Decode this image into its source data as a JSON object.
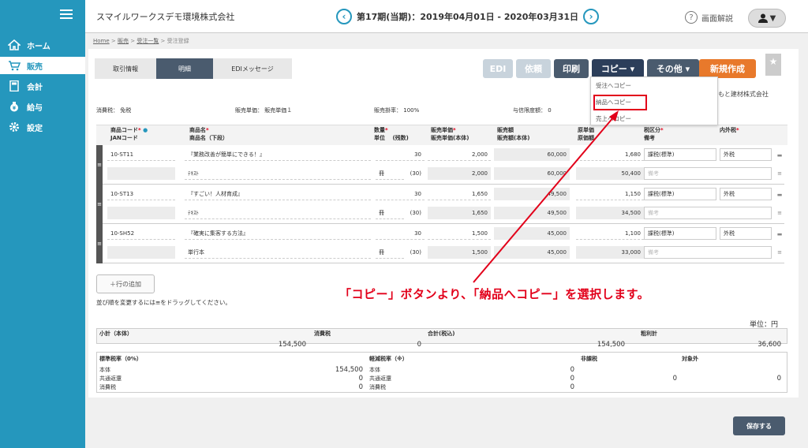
{
  "sidebar": {
    "items": [
      {
        "label": "ホーム",
        "icon": "home-icon"
      },
      {
        "label": "販売",
        "icon": "cart-icon"
      },
      {
        "label": "会計",
        "icon": "calculator-icon"
      },
      {
        "label": "給与",
        "icon": "moneybag-icon"
      },
      {
        "label": "設定",
        "icon": "gear-icon"
      }
    ]
  },
  "header": {
    "company": "スマイルワークスデモ環境株式会社",
    "period": "第17期(当期)：2019年04月01日 - 2020年03月31日",
    "help": "画面解説",
    "prev": "‹",
    "next": "›"
  },
  "breadcrumb": {
    "home": "Home",
    "sales": "販売",
    "list": "受注一覧",
    "current": "受注登録",
    "sep": " > "
  },
  "tabs": [
    "取引情報",
    "明細",
    "EDIメッセージ"
  ],
  "toolbar": {
    "edi": "EDI",
    "request": "依頼",
    "print": "印刷",
    "copy": "コピー ▾",
    "other": "その他 ▾",
    "new": "新規作成"
  },
  "copy_menu": [
    "受注へコピー",
    "納品へコピー",
    "売上へコピー"
  ],
  "supplier": "つもと建材株式会社",
  "info": {
    "tax": "消費税：",
    "tax_val": "免税",
    "unitprice": "販売単価：",
    "unitprice_val": "販売単価１",
    "rate": "販売掛率：",
    "rate_val": "100%",
    "credit": "与信限度額：",
    "credit_val": "0"
  },
  "columns": {
    "code": "商品コード",
    "jan": "JANコード",
    "name": "商品名",
    "name2": "商品名（下段）",
    "qty": "数量",
    "unit": "単位",
    "cases": "(残数)",
    "price": "販売単価",
    "price2": "販売単価(本体)",
    "amount": "販売額",
    "amount2": "販売額(本体)",
    "cost": "原単価",
    "cost2": "原価額",
    "taxcls": "税区分",
    "remark": "備考",
    "inout": "内外税"
  },
  "rows": [
    {
      "code": "10-ST11",
      "name": "『業務改善が簡単にできる！』",
      "name2": "ﾃｷｽﾄ",
      "qty": "30",
      "unit": "冊",
      "remain": "(30)",
      "price": "2,000",
      "price2": "2,000",
      "amount": "60,000",
      "amount2": "60,000",
      "cost": "1,680",
      "cost2": "50,400",
      "taxcls": "課税(標準)",
      "remark": "備考",
      "inout": "外税"
    },
    {
      "code": "10-ST13",
      "name": "『すごい！人材育成』",
      "name2": "ﾃｷｽﾄ",
      "qty": "30",
      "unit": "冊",
      "remain": "(30)",
      "price": "1,650",
      "price2": "1,650",
      "amount": "49,500",
      "amount2": "49,500",
      "cost": "1,150",
      "cost2": "34,500",
      "taxcls": "課税(標準)",
      "remark": "備考",
      "inout": "外税"
    },
    {
      "code": "10-SH52",
      "name": "『確実に集客する方法』",
      "name2": "単行本",
      "qty": "30",
      "unit": "冊",
      "remain": "(30)",
      "price": "1,500",
      "price2": "1,500",
      "amount": "45,000",
      "amount2": "45,000",
      "cost": "1,100",
      "cost2": "33,000",
      "taxcls": "課税(標準)",
      "remark": "備考",
      "inout": "外税"
    }
  ],
  "add_row": "＋行の追加",
  "note": "並び順を変更するには≡をドラッグしてください。",
  "annotation": "「コピー」ボタンより、「納品へコピー」を選択します。",
  "unit_label": "単位：円",
  "summary": {
    "subtotal": "小計（本体）",
    "subtotal_val": "154,500",
    "tax": "消費税",
    "tax_val": "0",
    "total": "合計(税込)",
    "total_val": "154,500",
    "profit": "粗利計",
    "profit_val": "36,600",
    "std": "標準税率（0%）",
    "reduced": "軽減税率（※）",
    "nontax": "非課税",
    "exempt": "対象外",
    "body": "本体",
    "common": "共通返還",
    "ctax": "消費税",
    "std_body": "154,500",
    "std_common": "0",
    "std_tax": "0",
    "red_body": "0",
    "red_common": "0",
    "red_tax": "0",
    "nontax_val": "0",
    "exempt_val": "0"
  },
  "save": "保存する",
  "colors": {
    "sidebar": "#2597bd",
    "accent_dark": "#2c3e5a",
    "orange": "#e8792b",
    "red": "#e2001a"
  }
}
